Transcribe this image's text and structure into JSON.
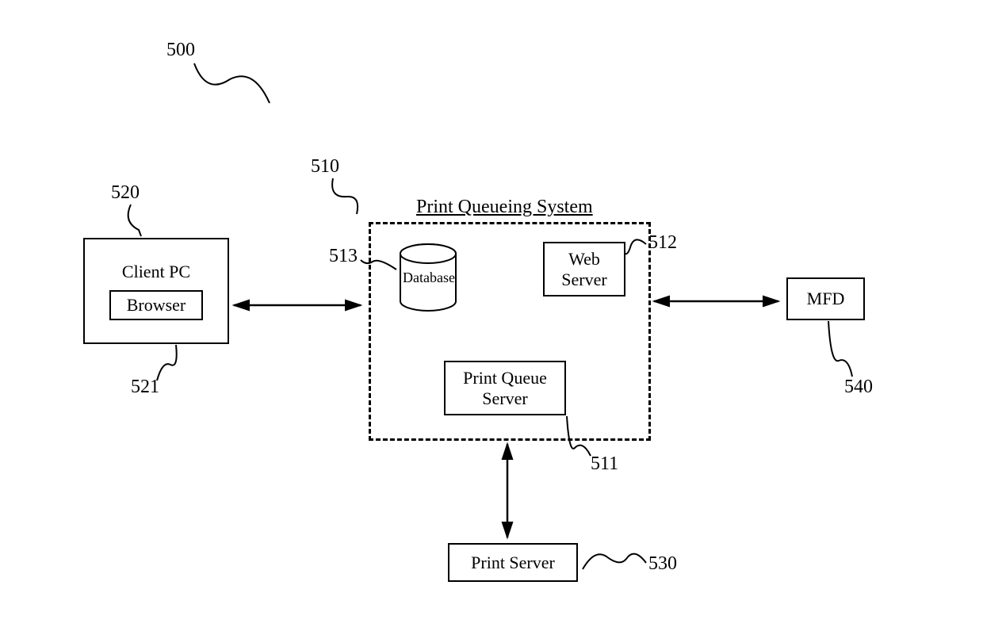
{
  "refs": {
    "system": "500",
    "queueSystem": "510",
    "printQueueServer": "511",
    "webServer": "512",
    "database": "513",
    "clientPC": "520",
    "browser": "521",
    "printServer": "530",
    "mfd": "540"
  },
  "labels": {
    "clientPC": "Client PC",
    "browser": "Browser",
    "queueTitle": "Print Queueing System",
    "database": "Database",
    "webServer": "Web\nServer",
    "printQueueServer": "Print Queue\nServer",
    "printServer": "Print Server",
    "mfd": "MFD"
  }
}
